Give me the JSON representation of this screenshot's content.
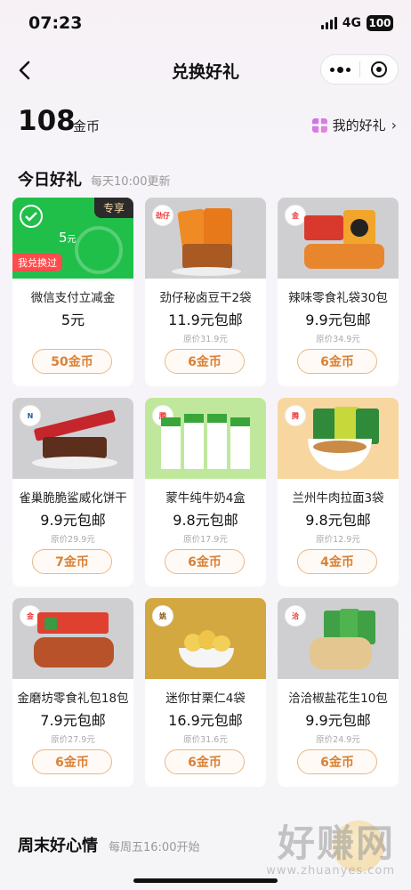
{
  "status": {
    "time": "07:23",
    "network": "4G",
    "battery": "100"
  },
  "nav": {
    "title": "兑换好礼"
  },
  "coins": {
    "amount": "108",
    "unit": "金币",
    "my_gifts": "我的好礼"
  },
  "today": {
    "title": "今日好礼",
    "subtitle": "每天10:00更新"
  },
  "cards": [
    {
      "name": "微信支付立减金",
      "price": "5元",
      "original": "",
      "button": "50金币",
      "tag": "专享",
      "badge": "我兑换过",
      "amount_main": "5",
      "amount_unit": "元"
    },
    {
      "name": "劲仔秘卤豆干2袋",
      "price": "11.9元包邮",
      "original": "原价31.9元",
      "button": "6金币",
      "brand": "劲仔"
    },
    {
      "name": "辣味零食礼袋30包",
      "price": "9.9元包邮",
      "original": "原价34.9元",
      "button": "6金币",
      "brand": "金磨坊"
    },
    {
      "name": "雀巢脆脆鲨威化饼干",
      "price": "9.9元包邮",
      "original": "原价29.9元",
      "button": "7金币",
      "brand": "Nestle"
    },
    {
      "name": "蒙牛纯牛奶4盒",
      "price": "9.8元包邮",
      "original": "原价17.9元",
      "button": "6金币",
      "brand": "腾讯"
    },
    {
      "name": "兰州牛肉拉面3袋",
      "price": "9.8元包邮",
      "original": "原价12.9元",
      "button": "4金币",
      "brand": "腾讯"
    },
    {
      "name": "金磨坊零食礼包18包",
      "price": "7.9元包邮",
      "original": "原价27.9元",
      "button": "6金币",
      "brand": "金磨坊"
    },
    {
      "name": "迷你甘栗仁4袋",
      "price": "16.9元包邮",
      "original": "原价31.6元",
      "button": "6金币",
      "brand": "姚生记"
    },
    {
      "name": "洽洽椒盐花生10包",
      "price": "9.9元包邮",
      "original": "原价24.9元",
      "button": "6金币",
      "brand": "洽洽"
    }
  ],
  "weekend": {
    "title": "周末好心情",
    "subtitle": "每周五16:00开始"
  },
  "watermark": {
    "text": "好赚网",
    "url": "www.zhuanyes.com"
  },
  "colors": {
    "accent": "#d98238",
    "wechat_green": "#20bf4a",
    "tag_red": "#ff4b4b"
  }
}
